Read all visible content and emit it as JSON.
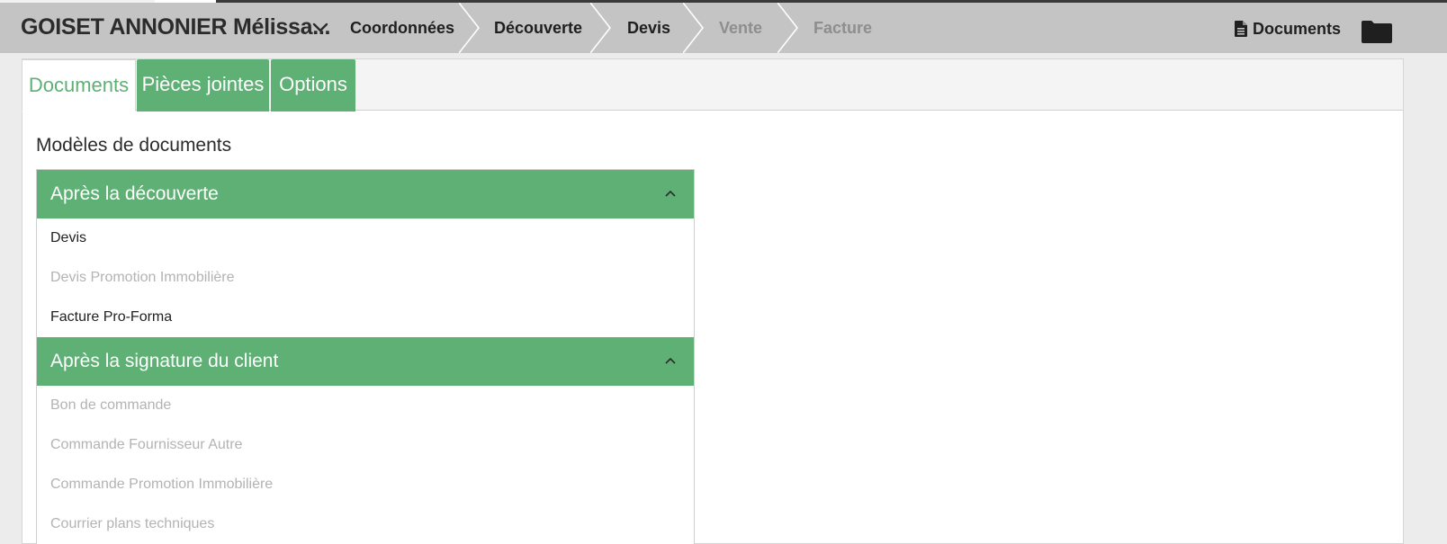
{
  "header": {
    "client_name": "GOISET ANNONIER Mélissa...",
    "steps": [
      {
        "label": "Coordonnées",
        "state": "active"
      },
      {
        "label": "Découverte",
        "state": "active"
      },
      {
        "label": "Devis",
        "state": "active"
      },
      {
        "label": "Vente",
        "state": "disabled"
      },
      {
        "label": "Facture",
        "state": "disabled"
      }
    ],
    "documents_label": "Documents",
    "icons": {
      "client_menu": "chevron-down-icon",
      "documents": "file-icon",
      "folder": "folder-icon"
    }
  },
  "tabs": [
    {
      "label": "Documents",
      "active": true
    },
    {
      "label": "Pièces jointes",
      "active": false
    },
    {
      "label": "Options",
      "active": false
    }
  ],
  "section_title": "Modèles de documents",
  "groups": [
    {
      "title": "Après la découverte",
      "expanded": true,
      "items": [
        {
          "label": "Devis",
          "enabled": true
        },
        {
          "label": "Devis Promotion Immobilière",
          "enabled": false
        },
        {
          "label": "Facture Pro-Forma",
          "enabled": true
        }
      ]
    },
    {
      "title": "Après la signature du client",
      "expanded": true,
      "items": [
        {
          "label": "Bon de commande",
          "enabled": false
        },
        {
          "label": "Commande Fournisseur Autre",
          "enabled": false
        },
        {
          "label": "Commande Promotion Immobilière",
          "enabled": false
        },
        {
          "label": "Courrier plans techniques",
          "enabled": false
        }
      ]
    }
  ],
  "colors": {
    "accent": "#5eb074",
    "header_bg": "#c4c4c4",
    "disabled_text": "#b3b3b3"
  }
}
